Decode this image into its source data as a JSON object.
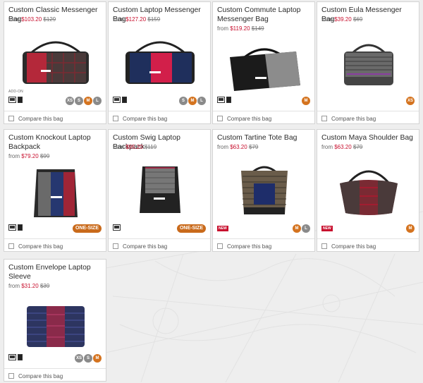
{
  "compare_label": "Compare this bag",
  "addon_label": "ADD-ON",
  "new_label": "NEW",
  "products": [
    {
      "name": "Custom Classic Messenger Bag",
      "from": "from",
      "price": "$103.20",
      "was": "$129",
      "sizes": [
        "XS",
        "S",
        "M",
        "L"
      ],
      "onesize": "",
      "layouts": [
        "laptop",
        "phone"
      ],
      "addon": true,
      "new": false
    },
    {
      "name": "Custom Laptop Messenger Bag",
      "from": "from",
      "price": "$127.20",
      "was": "$159",
      "sizes": [
        "S",
        "M",
        "L"
      ],
      "onesize": "",
      "layouts": [
        "laptop",
        "phone"
      ],
      "addon": false,
      "new": false
    },
    {
      "name": "Custom Commute Laptop Messenger Bag",
      "from": "from",
      "price": "$119.20",
      "was": "$149",
      "sizes": [
        "M"
      ],
      "onesize": "",
      "layouts": [
        "laptop",
        "phone"
      ],
      "addon": false,
      "new": false
    },
    {
      "name": "Custom Eula Messenger Bag",
      "from": "from",
      "price": "$39.20",
      "was": "$69",
      "sizes": [
        "XS"
      ],
      "onesize": "",
      "layouts": [],
      "addon": false,
      "new": false
    },
    {
      "name": "Custom Knockout Laptop Backpack",
      "from": "from",
      "price": "$79.20",
      "was": "$99",
      "sizes": [],
      "onesize": "ONE-SIZE",
      "layouts": [
        "laptop",
        "phone"
      ],
      "addon": false,
      "new": false
    },
    {
      "name": "Custom Swig Laptop Backpack",
      "from": "from",
      "price": "$95.20",
      "was": "$119",
      "sizes": [],
      "onesize": "ONE-SIZE",
      "layouts": [
        "laptop"
      ],
      "addon": false,
      "new": false
    },
    {
      "name": "Custom Tartine Tote Bag",
      "from": "from",
      "price": "$63.20",
      "was": "$79",
      "sizes": [
        "M",
        "L"
      ],
      "onesize": "",
      "layouts": [],
      "addon": false,
      "new": true
    },
    {
      "name": "Custom Maya Shoulder Bag",
      "from": "from",
      "price": "$63.20",
      "was": "$79",
      "sizes": [
        "M"
      ],
      "onesize": "",
      "layouts": [],
      "addon": false,
      "new": true
    },
    {
      "name": "Custom Envelope Laptop Sleeve",
      "from": "from",
      "price": "$31.20",
      "was": "$39",
      "sizes": [
        "XS",
        "S",
        "M"
      ],
      "onesize": "",
      "layouts": [
        "laptop",
        "phone"
      ],
      "addon": false,
      "new": false
    }
  ]
}
